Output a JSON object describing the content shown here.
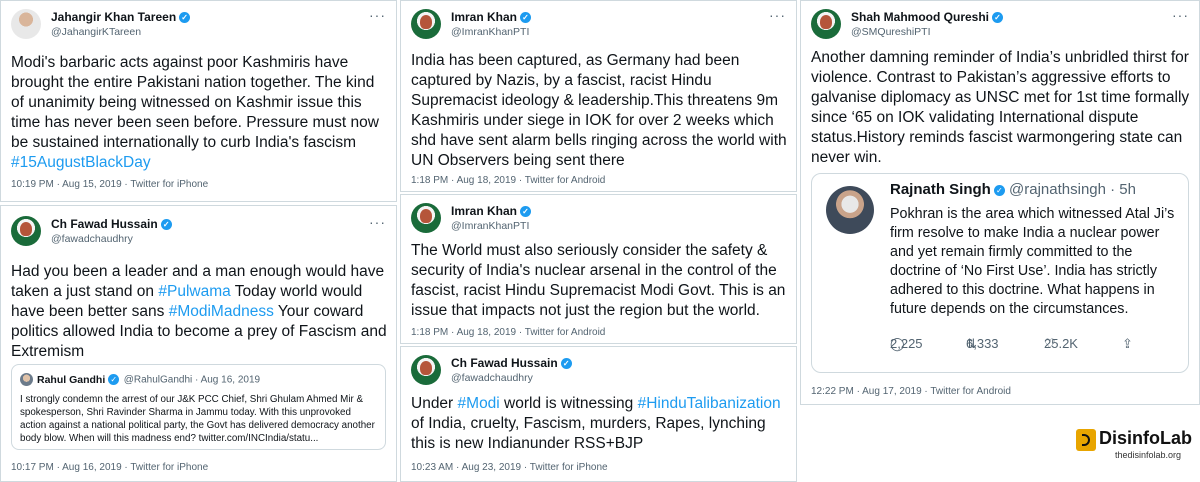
{
  "tweets": {
    "t1": {
      "name": "Jahangir Khan Tareen",
      "handle": "@JahangirKTareen",
      "text": "Modi's barbaric acts against poor Kashmiris have brought the entire Pakistani nation together. The kind of unanimity being witnessed on Kashmir issue this time has never been seen before. Pressure must now be sustained internationally to curb India's fascism",
      "hashtag": "#15AugustBlackDay",
      "meta": "10:19 PM · Aug 15, 2019 · Twitter for iPhone"
    },
    "t2": {
      "name": "Ch Fawad Hussain",
      "handle": "@fawadchaudhry",
      "text_1": "Had you been a leader and a man enough would have taken a just stand on ",
      "tag_1": "#Pulwama",
      "text_2": " Today world would have been better sans ",
      "tag_2": "#ModiMadness",
      "text_3": " Your coward politics allowed India to become a prey of Fascism and Extremism",
      "quote": {
        "name": "Rahul Gandhi",
        "handle_date": "@RahulGandhi · Aug 16, 2019",
        "text": "I strongly condemn the arrest of our J&K PCC Chief, Shri Ghulam Ahmed Mir & spokesperson, Shri Ravinder Sharma in Jammu today. With this unprovoked action against a national political party, the Govt has delivered democracy another body blow. When will this madness end? twitter.com/INCIndia/statu..."
      },
      "meta": "10:17 PM · Aug 16, 2019 · Twitter for iPhone"
    },
    "t3": {
      "name": "Imran Khan",
      "handle": "@ImranKhanPTI",
      "text": "India has been captured, as Germany had been captured by Nazis, by a fascist, racist Hindu Supremacist ideology & leadership.This threatens 9m Kashmiris under siege in IOK for over 2 weeks which shd have sent alarm bells ringing across the world with UN Observers being sent there",
      "meta": "1:18 PM · Aug 18, 2019 · Twitter for Android"
    },
    "t4": {
      "name": "Imran Khan",
      "handle": "@ImranKhanPTI",
      "text": "The World must also seriously consider  the safety & security of India's nuclear arsenal in the control of the fascist, racist Hindu Supremacist Modi Govt. This is an issue that impacts not just the region but the world.",
      "meta": "1:18 PM · Aug 18, 2019 · Twitter for Android"
    },
    "t5": {
      "name": "Ch Fawad Hussain",
      "handle": "@fawadchaudhry",
      "text_1": "Under ",
      "tag_1": "#Modi",
      "text_2": " world is witnessing ",
      "tag_2": "#HinduTalibanization",
      "text_3": " of India, cruelty, Fascism, murders, Rapes, lynching this is new Indianunder RSS+BJP",
      "meta": "10:23 AM · Aug 23, 2019 · Twitter for iPhone"
    },
    "t6": {
      "name": "Shah Mahmood Qureshi",
      "handle": "@SMQureshiPTI",
      "text": "Another damning reminder of India’s unbridled thirst for violence. Contrast to Pakistan’s aggressive efforts to galvanise diplomacy as UNSC met for 1st time formally since ‘65 on IOK validating International dispute status.History reminds fascist warmongering state can never win.",
      "embed": {
        "name": "Rajnath Singh",
        "handle_time": "@rajnathsingh · 5h",
        "text": "Pokhran is the area which witnessed Atal Ji’s firm resolve to make India a nuclear power and yet remain firmly committed to the doctrine of ‘No First Use’. India has strictly adhered to this doctrine. What happens in future depends on the circumstances.",
        "replies": "2,225",
        "retweets": "6,333",
        "likes": "25.2K"
      },
      "meta": "12:22 PM · Aug 17, 2019 · Twitter for Android"
    }
  },
  "icons": {
    "more": "more-dots-icon",
    "verified": "verified-badge-icon",
    "reply": "reply-icon",
    "retweet": "retweet-icon",
    "like": "heart-icon",
    "share": "share-icon"
  },
  "watermark": {
    "brand": "DisinfoLab",
    "url": "thedisinfolab.org"
  },
  "colors": {
    "link": "#1d9bf0",
    "text": "#0f1419",
    "muted": "#536471",
    "border": "#cfd9de",
    "brand_gold": "#e8a500"
  }
}
